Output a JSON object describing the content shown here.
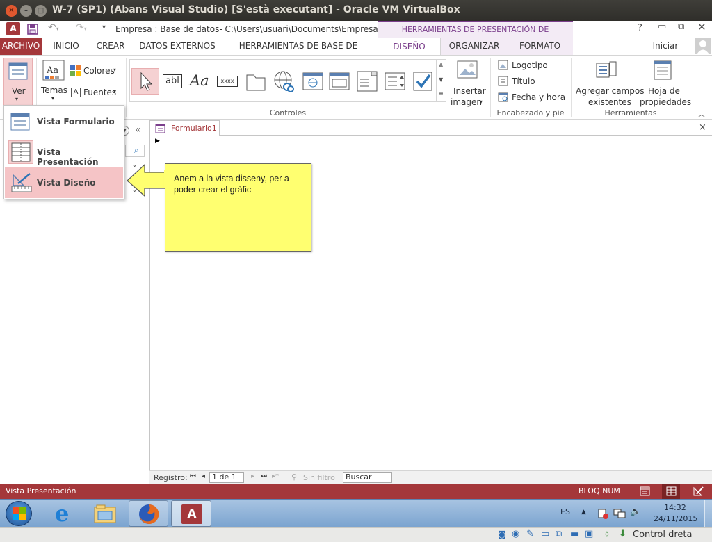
{
  "os": {
    "window_title": "W-7 (SP1) (Abans Visual Studio) [S'està executant] - Oracle VM VirtualBox"
  },
  "qat": {
    "doc_path": "Empresa : Base de datos- C:\\Users\\usuari\\Documents\\Empresa.acc...",
    "help": "?"
  },
  "ribbon": {
    "context_header": "HERRAMIENTAS DE PRESENTACIÓN DE FORMULARIO",
    "tabs": [
      "ARCHIVO",
      "INICIO",
      "CREAR",
      "DATOS EXTERNOS",
      "HERRAMIENTAS DE BASE DE DATOS",
      "DISEÑO",
      "ORGANIZAR",
      "FORMATO"
    ],
    "sign_in": "Iniciar sesión",
    "ver": "Ver",
    "temas": "Temas",
    "colores": "Colores",
    "fuentes": "Fuentes",
    "ctl_text_sample": "xxxx",
    "ctl_label_sample": "abl",
    "ctl_aa": "Aa",
    "group_controles": "Controles",
    "insertar_1": "Insertar",
    "insertar_2": "imagen",
    "logotipo": "Logotipo",
    "titulo": "Título",
    "fecha_hora": "Fecha y hora",
    "group_encabezado": "Encabezado y pie d...",
    "agregar_1": "Agregar campos",
    "agregar_2": "existentes",
    "hoja_1": "Hoja de",
    "hoja_2": "propiedades",
    "group_herramientas": "Herramientas"
  },
  "view_menu": {
    "items": [
      "Vista Formulario",
      "Vista Presentación",
      "Vista Diseño"
    ]
  },
  "document": {
    "tab": "Formulario1",
    "close": "×"
  },
  "callout": {
    "text": "Anem a la vista disseny, per a poder crear el gràfic"
  },
  "record_nav": {
    "label": "Registro:",
    "position": "1 de 1",
    "filter": "Sin filtro",
    "search": "Buscar"
  },
  "status": {
    "left": "Vista Presentación",
    "bloq": "BLOQ NUM"
  },
  "taskbar": {
    "lang": "ES",
    "time": "14:32",
    "date": "24/11/2015"
  },
  "vbox": {
    "host_key": "Control dreta"
  },
  "colors": {
    "access_red": "#a4373a",
    "context_purple": "#7b3f8c",
    "callout_yellow": "#ffff70"
  }
}
